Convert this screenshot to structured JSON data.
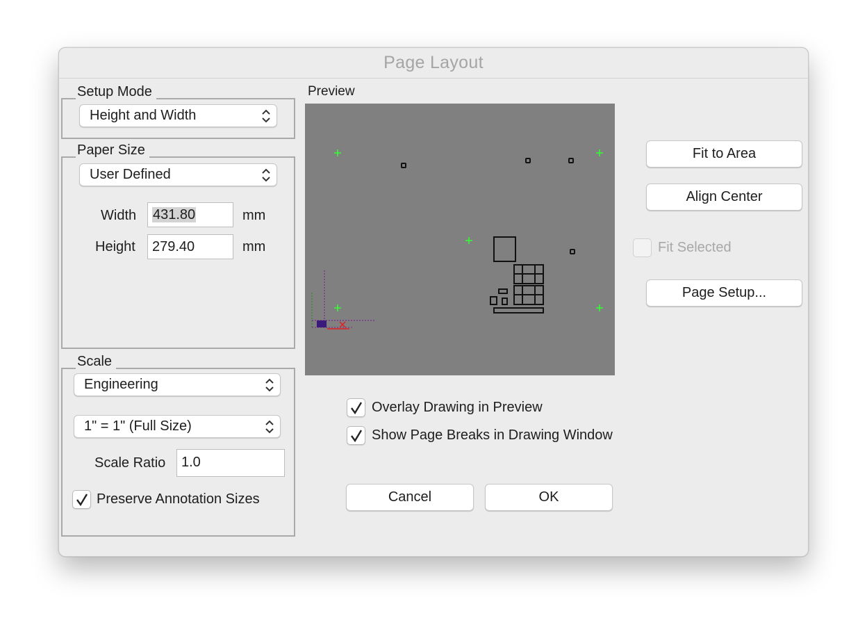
{
  "window": {
    "title": "Page Layout"
  },
  "setup_mode": {
    "label": "Setup Mode",
    "selected": "Height and Width"
  },
  "paper_size": {
    "label": "Paper Size",
    "selected": "User Defined",
    "width_label": "Width",
    "width_value": "431.80",
    "width_unit": "mm",
    "height_label": "Height",
    "height_value": "279.40",
    "height_unit": "mm"
  },
  "scale": {
    "label": "Scale",
    "type_selected": "Engineering",
    "ratio_selected": "1\" = 1\" (Full Size)",
    "ratio_label": "Scale Ratio",
    "ratio_value": "1.0",
    "preserve_label": "Preserve Annotation Sizes",
    "preserve_checked": true
  },
  "preview": {
    "label": "Preview",
    "background": "#808080",
    "marker_color": "#33ff33"
  },
  "options": {
    "overlay_label": "Overlay Drawing in Preview",
    "overlay_checked": true,
    "page_breaks_label": "Show Page Breaks in Drawing Window",
    "page_breaks_checked": true
  },
  "side_buttons": {
    "fit_to_area": "Fit to Area",
    "align_center": "Align Center",
    "fit_selected": "Fit Selected",
    "fit_selected_enabled": false,
    "page_setup": "Page Setup..."
  },
  "footer": {
    "cancel": "Cancel",
    "ok": "OK"
  },
  "icons": {
    "popup": "up-down-chevron-icon",
    "check": "checkmark-icon"
  }
}
